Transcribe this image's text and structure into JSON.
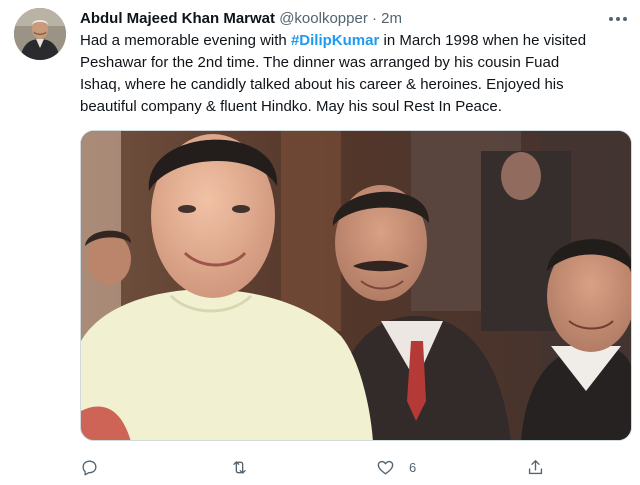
{
  "tweet": {
    "author_name": "Abdul Majeed Khan Marwat",
    "handle": "@koolkopper",
    "separator": "·",
    "time": "2m",
    "text": {
      "line1_before": "Had a memorable evening with ",
      "hashtag": "#DilipKumar",
      "line1_after": " in March 1998 when he visited",
      "line2": "Peshawar for the 2nd time. The dinner was arranged by his cousin Fuad",
      "line3": "Ishaq, where he candidly talked about his career & heroines. Enjoyed his",
      "line4": "beautiful company & fluent Hindko. May his soul Rest In Peace."
    }
  },
  "actions": {
    "reply_icon": "reply-icon",
    "retweet_icon": "retweet-icon",
    "like_icon": "heart-icon",
    "like_count": "6",
    "share_icon": "share-icon"
  },
  "colors": {
    "link": "#1d9bf0",
    "secondary_text": "#536471",
    "primary_text": "#0f1419",
    "border": "#cfd9de"
  }
}
